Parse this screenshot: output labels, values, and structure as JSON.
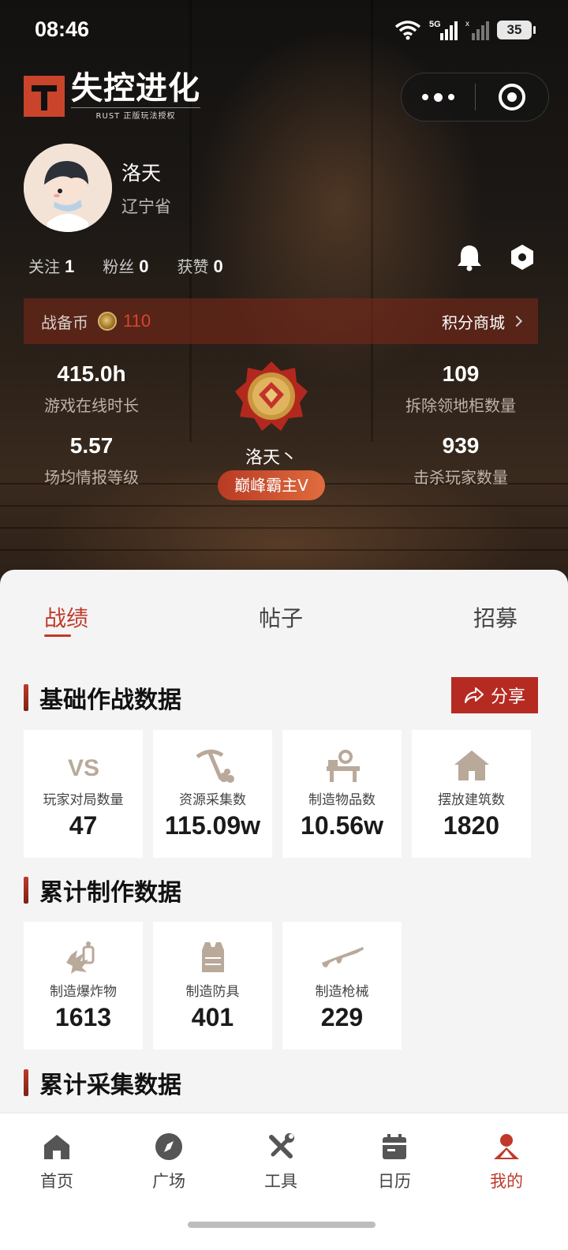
{
  "status_bar": {
    "time": "08:46",
    "network": "5G",
    "battery": "35"
  },
  "app": {
    "logo_title": "失控进化",
    "logo_subtitle": "RUST 正版玩法授权"
  },
  "profile": {
    "username": "洛天",
    "province": "辽宁省",
    "follow_label": "关注",
    "follow_count": "1",
    "fans_label": "粉丝",
    "fans_count": "0",
    "likes_label": "获赞",
    "likes_count": "0"
  },
  "coins": {
    "label": "战备币",
    "value": "110",
    "mall_label": "积分商城"
  },
  "stats": {
    "online_time": "415.0h",
    "online_time_label": "游戏在线时长",
    "cabinets": "109",
    "cabinets_label": "拆除领地柜数量",
    "intel_level": "5.57",
    "intel_level_label": "场均情报等级",
    "kills": "939",
    "kills_label": "击杀玩家数量",
    "player_name": "洛天丶",
    "rank": "巅峰霸主V"
  },
  "tabs": [
    "战绩",
    "帖子",
    "招募"
  ],
  "sections": {
    "basic": {
      "title": "基础作战数据",
      "share_label": "分享",
      "cards": [
        {
          "icon": "vs-icon",
          "label": "玩家对局数量",
          "value": "47"
        },
        {
          "icon": "pickaxe-icon",
          "label": "资源采集数",
          "value": "115.09w"
        },
        {
          "icon": "workbench-icon",
          "label": "制造物品数",
          "value": "10.56w"
        },
        {
          "icon": "house-icon",
          "label": "摆放建筑数",
          "value": "1820"
        }
      ]
    },
    "craft": {
      "title": "累计制作数据",
      "cards": [
        {
          "icon": "explosive-icon",
          "label": "制造爆炸物",
          "value": "1613"
        },
        {
          "icon": "armor-icon",
          "label": "制造防具",
          "value": "401"
        },
        {
          "icon": "rifle-icon",
          "label": "制造枪械",
          "value": "229"
        }
      ]
    },
    "gather": {
      "title": "累计采集数据"
    }
  },
  "nav": [
    {
      "icon": "home-icon",
      "label": "首页"
    },
    {
      "icon": "compass-icon",
      "label": "广场"
    },
    {
      "icon": "tools-icon",
      "label": "工具"
    },
    {
      "icon": "calendar-icon",
      "label": "日历"
    },
    {
      "icon": "profile-icon",
      "label": "我的"
    }
  ],
  "colors": {
    "accent": "#c0392b",
    "share_button": "#b52b22",
    "coin_value": "#d9442e"
  }
}
